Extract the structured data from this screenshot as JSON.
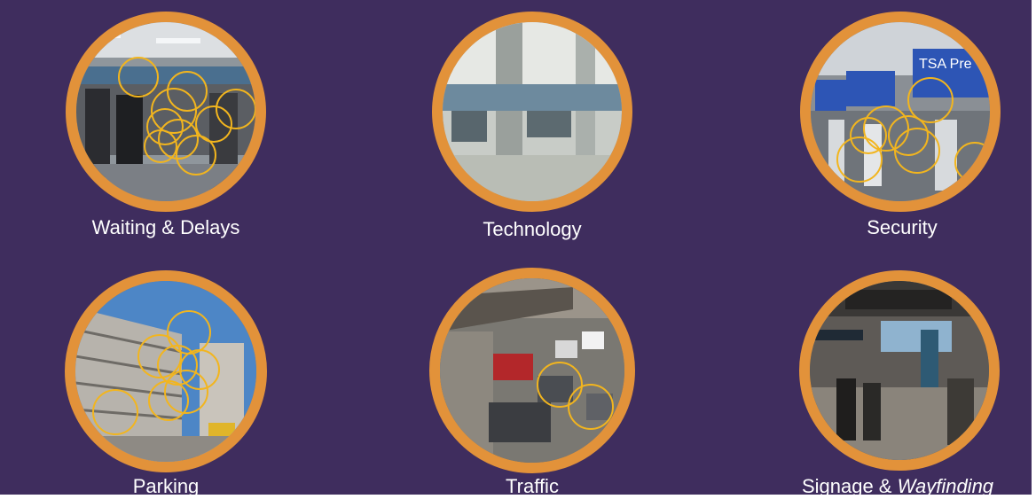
{
  "tiles": [
    {
      "id": "waiting",
      "label": "Waiting & Delays",
      "scene": "airport check-in line"
    },
    {
      "id": "technology",
      "label": "Technology",
      "scene": "airport terminal kiosks"
    },
    {
      "id": "security",
      "label": "Security",
      "scene": "TSA checkpoint",
      "sign_text": "TSA Pre"
    },
    {
      "id": "parking",
      "label": "Parking",
      "scene": "parking garage"
    },
    {
      "id": "traffic",
      "label": "Traffic",
      "scene": "curbside traffic"
    },
    {
      "id": "signage",
      "label_main": "Signage & ",
      "label_em": "Wayfinding",
      "scene": "terminal corridor with signs"
    }
  ],
  "colors": {
    "background": "#3f2d5e",
    "ring": "#e2923a",
    "highlight_circle": "#f2b51e",
    "text": "#ffffff"
  }
}
